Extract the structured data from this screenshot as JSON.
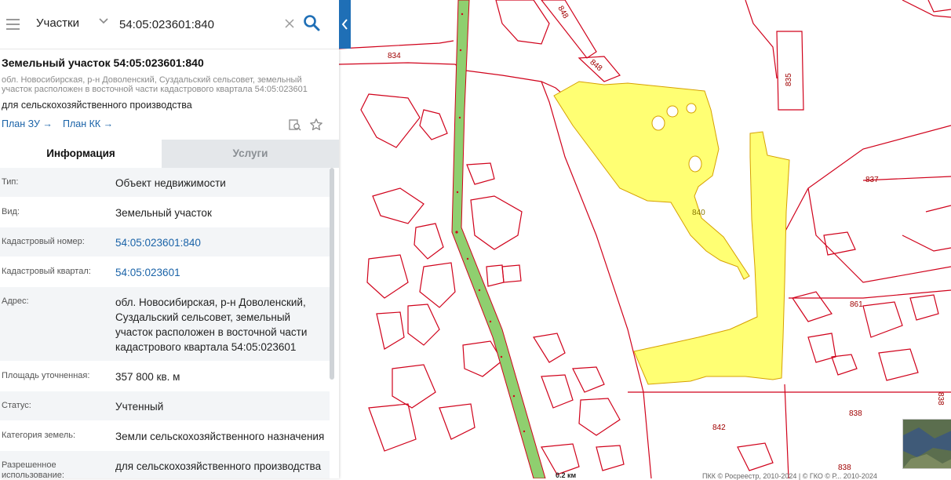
{
  "search": {
    "layer": "Участки",
    "query": "54:05:023601:840"
  },
  "object": {
    "title": "Земельный участок 54:05:023601:840",
    "address_short": "обл. Новосибирская, р-н Доволенский, Суздальский сельсовет, земельный участок расположен в восточной части кадастрового квартала 54:05:023601",
    "usage_short": "для сельскохозяйственного производства",
    "plan_zu": "План ЗУ →",
    "plan_kk": "План КК →"
  },
  "tabs": {
    "info": "Информация",
    "services": "Услуги"
  },
  "rows": [
    {
      "key": "Тип:",
      "value": "Объект недвижимости"
    },
    {
      "key": "Вид:",
      "value": "Земельный участок"
    },
    {
      "key": "Кадастровый номер:",
      "value": "54:05:023601:840"
    },
    {
      "key": "Кадастровый квартал:",
      "value": "54:05:023601"
    },
    {
      "key": "Адрес:",
      "value": "обл. Новосибирская, р-н Доволенский, Суздальский сельсовет, земельный участок расположен в восточной части кадастрового квартала 54:05:023601"
    },
    {
      "key": "Площадь уточненная:",
      "value": "357 800 кв. м"
    },
    {
      "key": "Статус:",
      "value": "Учтенный"
    },
    {
      "key": "Категория земель:",
      "value": "Земли сельскохозяйственного назначения"
    },
    {
      "key": "Разрешенное использование:",
      "value": "для сельскохозяйственного производства"
    }
  ],
  "map": {
    "parcel_labels": [
      "834",
      "848",
      "848",
      "835",
      "837",
      "840",
      "861",
      "838",
      "838",
      "842",
      "838"
    ],
    "selected_parcel": "840",
    "scale": "0.2 км",
    "attribution": "ПКК © Росреестр, 2010-2024 | © ГКО © Р... 2010-2024"
  },
  "colors": {
    "accent": "#1f6fb6",
    "link": "#1a63a8",
    "parcel_border": "#d0021b",
    "selected_fill": "#ffff73",
    "road_fill": "#8fcf6f"
  }
}
